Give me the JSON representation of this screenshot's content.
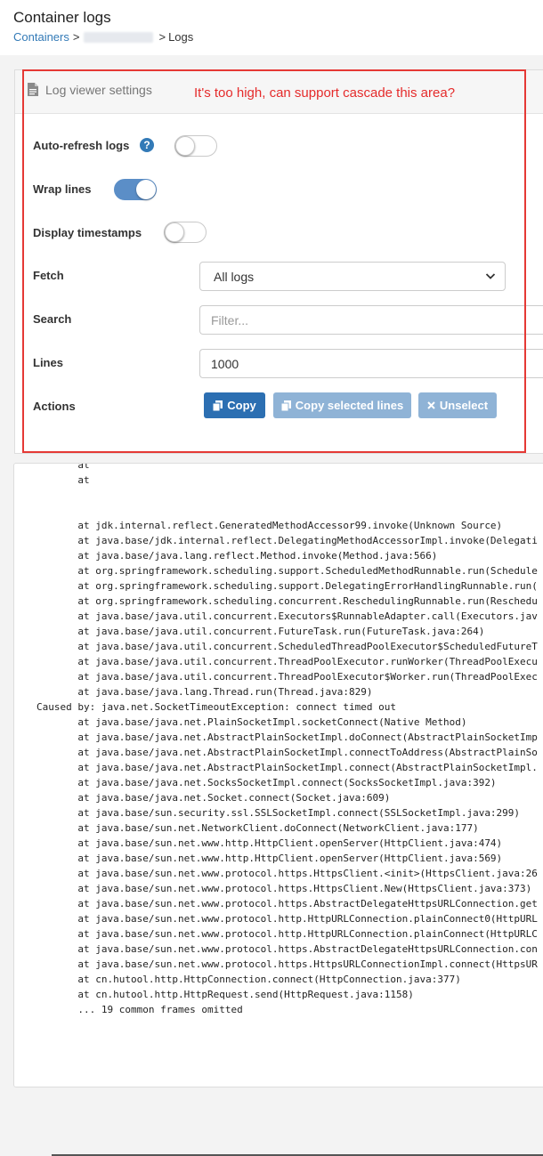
{
  "header": {
    "title": "Container logs",
    "breadcrumb": {
      "containers": "Containers",
      "sep1": ">",
      "sep2": ">",
      "current": "Logs"
    }
  },
  "settings": {
    "title": "Log viewer settings",
    "annotation": "It's too high, can support cascade this area?",
    "auto_refresh_label": "Auto-refresh logs",
    "auto_refresh_on": false,
    "help_glyph": "?",
    "wrap_lines_label": "Wrap lines",
    "wrap_lines_on": true,
    "timestamps_label": "Display timestamps",
    "timestamps_on": false,
    "fetch_label": "Fetch",
    "fetch_value": "All logs",
    "search_label": "Search",
    "search_placeholder": "Filter...",
    "lines_label": "Lines",
    "lines_value": "1000",
    "actions_label": "Actions",
    "copy_label": "Copy",
    "copy_selected_label": "Copy selected lines",
    "unselect_label": "Unselect",
    "accent_color": "#2c6fb2",
    "annotation_color": "#e52b2b"
  },
  "logs": {
    "lines": [
      "       at",
      "       at",
      "",
      "",
      "       at jdk.internal.reflect.GeneratedMethodAccessor99.invoke(Unknown Source)",
      "       at java.base/jdk.internal.reflect.DelegatingMethodAccessorImpl.invoke(Delegati",
      "       at java.base/java.lang.reflect.Method.invoke(Method.java:566)",
      "       at org.springframework.scheduling.support.ScheduledMethodRunnable.run(Schedule",
      "       at org.springframework.scheduling.support.DelegatingErrorHandlingRunnable.run(",
      "       at org.springframework.scheduling.concurrent.ReschedulingRunnable.run(Reschedu",
      "       at java.base/java.util.concurrent.Executors$RunnableAdapter.call(Executors.jav",
      "       at java.base/java.util.concurrent.FutureTask.run(FutureTask.java:264)",
      "       at java.base/java.util.concurrent.ScheduledThreadPoolExecutor$ScheduledFutureT",
      "       at java.base/java.util.concurrent.ThreadPoolExecutor.runWorker(ThreadPoolExecu",
      "       at java.base/java.util.concurrent.ThreadPoolExecutor$Worker.run(ThreadPoolExec",
      "       at java.base/java.lang.Thread.run(Thread.java:829)",
      "Caused by: java.net.SocketTimeoutException: connect timed out",
      "       at java.base/java.net.PlainSocketImpl.socketConnect(Native Method)",
      "       at java.base/java.net.AbstractPlainSocketImpl.doConnect(AbstractPlainSocketImp",
      "       at java.base/java.net.AbstractPlainSocketImpl.connectToAddress(AbstractPlainSo",
      "       at java.base/java.net.AbstractPlainSocketImpl.connect(AbstractPlainSocketImpl.",
      "       at java.base/java.net.SocksSocketImpl.connect(SocksSocketImpl.java:392)",
      "       at java.base/java.net.Socket.connect(Socket.java:609)",
      "       at java.base/sun.security.ssl.SSLSocketImpl.connect(SSLSocketImpl.java:299)",
      "       at java.base/sun.net.NetworkClient.doConnect(NetworkClient.java:177)",
      "       at java.base/sun.net.www.http.HttpClient.openServer(HttpClient.java:474)",
      "       at java.base/sun.net.www.http.HttpClient.openServer(HttpClient.java:569)",
      "       at java.base/sun.net.www.protocol.https.HttpsClient.<init>(HttpsClient.java:26",
      "       at java.base/sun.net.www.protocol.https.HttpsClient.New(HttpsClient.java:373)",
      "       at java.base/sun.net.www.protocol.https.AbstractDelegateHttpsURLConnection.get",
      "       at java.base/sun.net.www.protocol.http.HttpURLConnection.plainConnect0(HttpURL",
      "       at java.base/sun.net.www.protocol.http.HttpURLConnection.plainConnect(HttpURLC",
      "       at java.base/sun.net.www.protocol.https.AbstractDelegateHttpsURLConnection.con",
      "       at java.base/sun.net.www.protocol.https.HttpsURLConnectionImpl.connect(HttpsUR",
      "       at cn.hutool.http.HttpConnection.connect(HttpConnection.java:377)",
      "       at cn.hutool.http.HttpRequest.send(HttpRequest.java:1158)",
      "       ... 19 common frames omitted"
    ]
  }
}
